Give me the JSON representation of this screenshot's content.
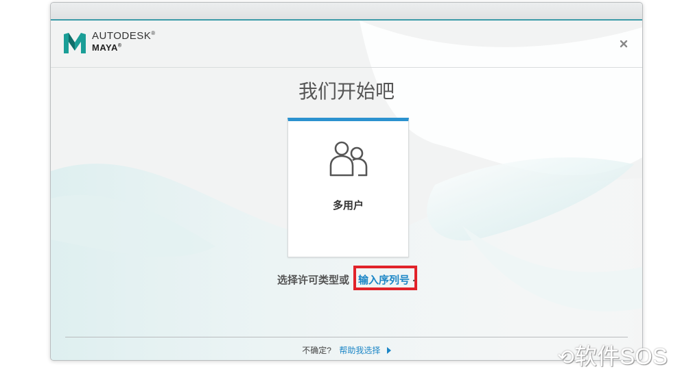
{
  "header": {
    "brand_line1": "AUTODESK",
    "brand_line2": "MAYA",
    "registered_mark": "®",
    "close_icon": "close-icon"
  },
  "main": {
    "title": "我们开始吧",
    "license_card": {
      "icon": "users-icon",
      "label": "多用户"
    },
    "instruction_text": "选择许可类型或",
    "serial_link": "输入序列号",
    "serial_suffix": "."
  },
  "footer": {
    "question": "不确定?",
    "help_link": "帮助我选择",
    "arrow_icon": "triangle-right-icon"
  },
  "watermark": {
    "text": "软件SOS",
    "icon": "swirl-logo-icon"
  },
  "colors": {
    "accent_blue": "#2b92cf",
    "link_blue": "#1c86c6",
    "highlight_red": "#e1232a",
    "title_bar_teal": "#3a9aa7"
  }
}
